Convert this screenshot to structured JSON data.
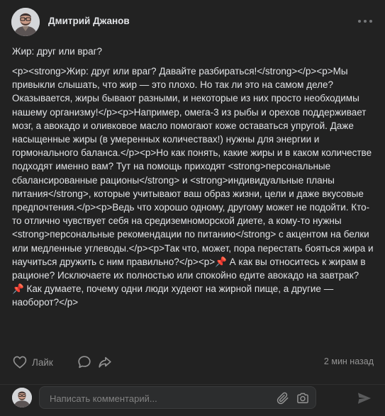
{
  "post": {
    "author": "Дмитрий Джанов",
    "title": "Жир: друг или враг?",
    "body": "<p><strong>Жир: друг или враг? Давайте разбираться!</strong></p><p>Мы привыкли слышать, что жир — это плохо. Но так ли это на самом деле? Оказывается, жиры бывают разными, и некоторые из них просто необходимы нашему организму!</p><p>Например, омега-3 из рыбы и орехов поддерживает мозг, а авокадо и оливковое масло помогают коже оставаться упругой. Даже насыщенные жиры (в умеренных количествах!) нужны для энергии и гормонального баланса.</p><p>Но как понять, какие жиры и в каком количестве подходят именно вам? Тут на помощь приходят <strong>персональные сбалансированные рационы</strong> и <strong>индивидуальные планы питания</strong>, которые учитывают ваш образ жизни, цели и даже вкусовые предпочтения.</p><p>Ведь что хорошо одному, другому может не подойти. Кто-то отлично чувствует себя на средиземноморской диете, а кому-то нужны <strong>персональные рекомендации по питанию</strong> с акцентом на белки или медленные углеводы.</p><p>Так что, может, пора перестать бояться жира и научиться дружить с ним правильно?</p><p>📌 А как вы относитесь к жирам в рационе? Исключаете их полностью или спокойно едите авокадо на завтрак?\n📌 Как думаете, почему одни люди худеют на жирной пище, а другие — наоборот?</p>",
    "like_label": "Лайк",
    "timestamp": "2 мин назад"
  },
  "comment": {
    "placeholder": "Написать комментарий..."
  },
  "icons": {
    "more": "more-dots-icon",
    "like": "heart-icon",
    "comment": "comment-bubble-icon",
    "share": "share-arrow-icon",
    "attach": "paperclip-icon",
    "camera": "camera-icon",
    "send": "send-icon"
  },
  "colors": {
    "background": "#222222",
    "text": "#e1e3e6",
    "muted": "#939393",
    "input_background": "#2c2d2e"
  }
}
